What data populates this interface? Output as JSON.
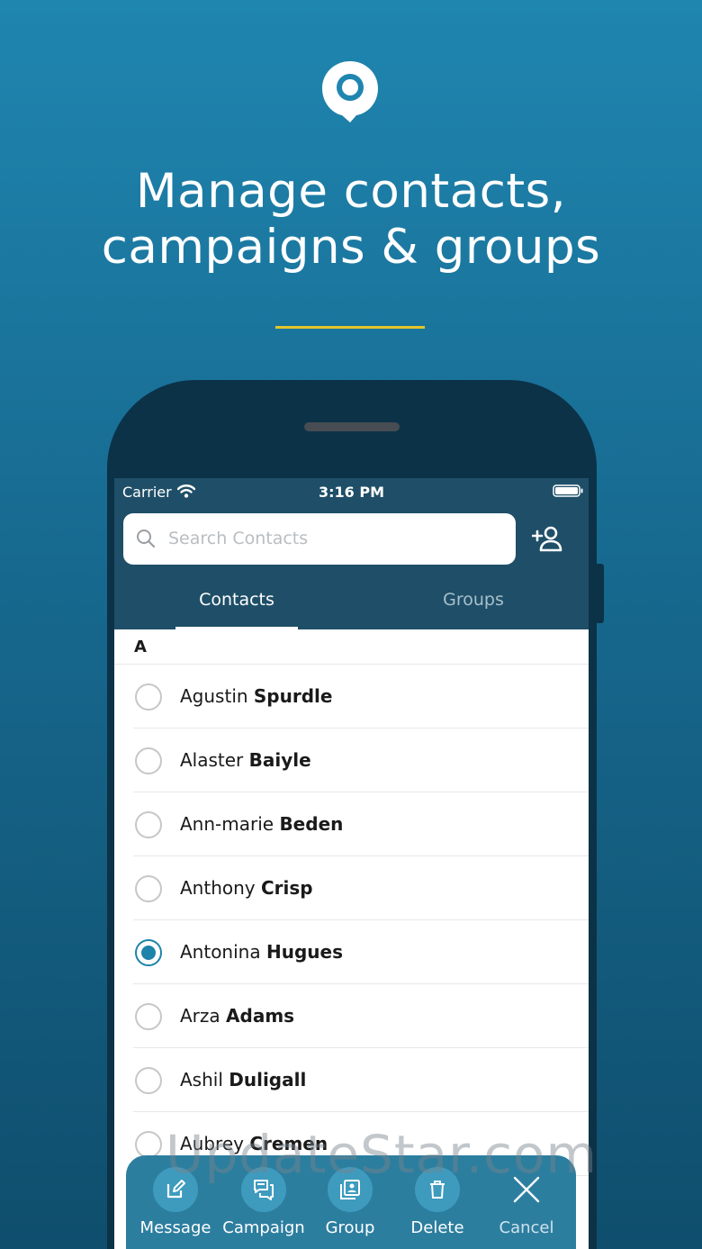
{
  "headline": {
    "line1": "Manage contacts,",
    "line2": "campaigns & groups"
  },
  "status_bar": {
    "carrier": "Carrier",
    "time": "3:16 PM"
  },
  "search": {
    "placeholder": "Search Contacts"
  },
  "tabs": [
    {
      "label": "Contacts",
      "selected": true
    },
    {
      "label": "Groups",
      "selected": false
    }
  ],
  "section_letter": "A",
  "contacts": [
    {
      "first": "Agustin",
      "last": "Spurdle",
      "selected": false
    },
    {
      "first": "Alaster",
      "last": "Baiyle",
      "selected": false
    },
    {
      "first": "Ann-marie",
      "last": "Beden",
      "selected": false
    },
    {
      "first": "Anthony",
      "last": "Crisp",
      "selected": false
    },
    {
      "first": "Antonina",
      "last": "Hugues",
      "selected": true
    },
    {
      "first": "Arza",
      "last": "Adams",
      "selected": false
    },
    {
      "first": "Ashil",
      "last": "Duligall",
      "selected": false
    },
    {
      "first": "Aubrey",
      "last": "Cremen",
      "selected": false
    }
  ],
  "actions": [
    {
      "label": "Message",
      "icon": "edit-icon"
    },
    {
      "label": "Campaign",
      "icon": "chat-icon"
    },
    {
      "label": "Group",
      "icon": "group-icon"
    },
    {
      "label": "Delete",
      "icon": "trash-icon"
    },
    {
      "label": "Cancel",
      "icon": "close-icon"
    }
  ],
  "watermark": "UpdateStar.com",
  "colors": {
    "accent": "#1e83a9",
    "header": "#1f4f68",
    "divider": "#e2c52c",
    "action_bar": "#2c7e9f"
  }
}
